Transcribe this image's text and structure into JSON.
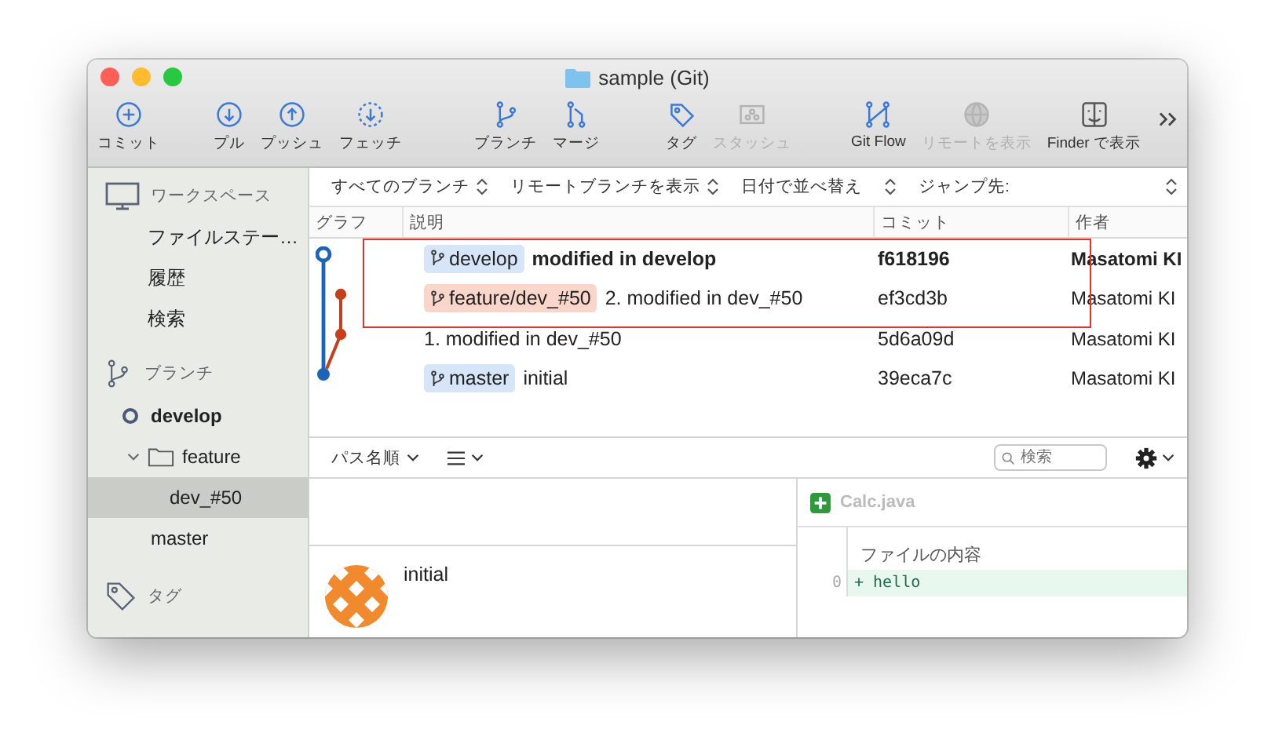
{
  "window": {
    "title": "sample (Git)"
  },
  "toolbar": {
    "groups": [
      [
        {
          "label": "コミット",
          "disabled": false
        }
      ],
      [
        {
          "label": "プル",
          "disabled": false
        },
        {
          "label": "プッシュ",
          "disabled": false
        },
        {
          "label": "フェッチ",
          "disabled": false
        }
      ],
      [
        {
          "label": "ブランチ",
          "disabled": false
        },
        {
          "label": "マージ",
          "disabled": false
        }
      ],
      [
        {
          "label": "タグ",
          "disabled": false
        },
        {
          "label": "スタッシュ",
          "disabled": true
        }
      ],
      [
        {
          "label": "Git Flow",
          "disabled": false
        },
        {
          "label": "リモートを表示",
          "disabled": true
        },
        {
          "label": "Finder で表示",
          "disabled": false
        }
      ]
    ]
  },
  "sidebar": {
    "workspace": {
      "label": "ワークスペース",
      "items": [
        {
          "label": "ファイルステー…",
          "selected": false
        },
        {
          "label": "履歴",
          "selected": false
        },
        {
          "label": "検索",
          "selected": false
        }
      ]
    },
    "branches": {
      "label": "ブランチ",
      "items": [
        {
          "label": "develop",
          "current": true,
          "selected": false
        },
        {
          "label": "feature",
          "kind": "folder",
          "expanded": true,
          "children": [
            {
              "label": "dev_#50",
              "current": false,
              "selected": true
            }
          ]
        },
        {
          "label": "master",
          "current": false,
          "selected": false
        }
      ]
    },
    "tags": {
      "label": "タグ"
    }
  },
  "filters": [
    {
      "label": "すべてのブランチ",
      "kind": "popup"
    },
    {
      "label": "リモートブランチを表示",
      "kind": "popup"
    },
    {
      "label": "日付で並べ替え",
      "kind": "popup"
    },
    {
      "label": "ジャンプ先:",
      "kind": "jump"
    }
  ],
  "table": {
    "columns": [
      "グラフ",
      "説明",
      "コミット",
      "作者"
    ],
    "rows": [
      {
        "branch": {
          "label": "develop",
          "color": "#d6e5f7"
        },
        "description": "modified in develop",
        "commit": "f618196",
        "author": "Masatomi KI",
        "head": true
      },
      {
        "branch": {
          "label": "feature/dev_#50",
          "color": "#f9d5ca"
        },
        "description": "2. modified in dev_#50",
        "commit": "ef3cd3b",
        "author": "Masatomi KI",
        "head": false
      },
      {
        "description": "1. modified in dev_#50",
        "commit": "5d6a09d",
        "author": "Masatomi KI",
        "head": false
      },
      {
        "branch": {
          "label": "master",
          "color": "#d6e5f7"
        },
        "description": "initial",
        "commit": "39eca7c",
        "author": "Masatomi KI",
        "head": false
      }
    ]
  },
  "bottom_bar": {
    "sort": "パス名順",
    "search": {
      "placeholder": "検索"
    }
  },
  "commit": {
    "message": "initial"
  },
  "diff": {
    "file": "Calc.java",
    "heading": "ファイルの内容",
    "lines": [
      {
        "number": "0",
        "sign": "+",
        "text": "hello",
        "kind": "added"
      }
    ]
  }
}
